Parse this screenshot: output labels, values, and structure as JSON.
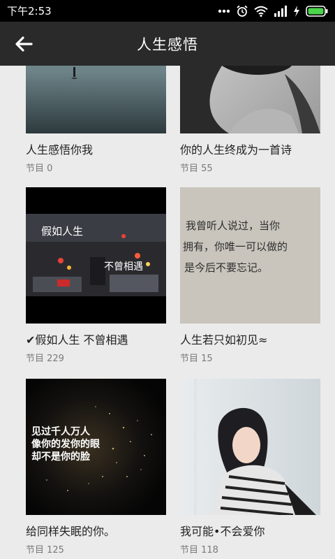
{
  "status_bar": {
    "time": "下午2:53",
    "icons": [
      "more-dots-icon",
      "alarm-icon",
      "wifi-icon",
      "signal-icon",
      "charging-icon",
      "battery-icon"
    ]
  },
  "header": {
    "title": "人生感悟",
    "back_icon": "back-arrow-icon"
  },
  "colors": {
    "status_bar_bg": "#000000",
    "header_bg": "#2a2a2a",
    "page_bg": "#ebebeb",
    "battery": "#4cd44c"
  },
  "programs": [
    {
      "title": "人生感悟你我",
      "count": "节目 0"
    },
    {
      "title": "你的人生终成为一首诗",
      "count": "节目 55"
    },
    {
      "title": "✔假如人生   不曾相遇",
      "count": "节目 229",
      "image_text": [
        "假如人生",
        "不曾相遇"
      ]
    },
    {
      "title": "人生若只如初见≈",
      "count": "节目 15",
      "image_text": [
        "我曾听人说过，当你",
        "拥有，你唯一可以做的",
        "是今后不要忘记。"
      ]
    },
    {
      "title": "给同样失眠的你。",
      "count": "节目 125",
      "image_text": [
        "见过千人万人",
        "像你的发你的眼",
        "却不是你的脸"
      ]
    },
    {
      "title": "我可能•不会爱你",
      "count": "节目 118"
    }
  ]
}
